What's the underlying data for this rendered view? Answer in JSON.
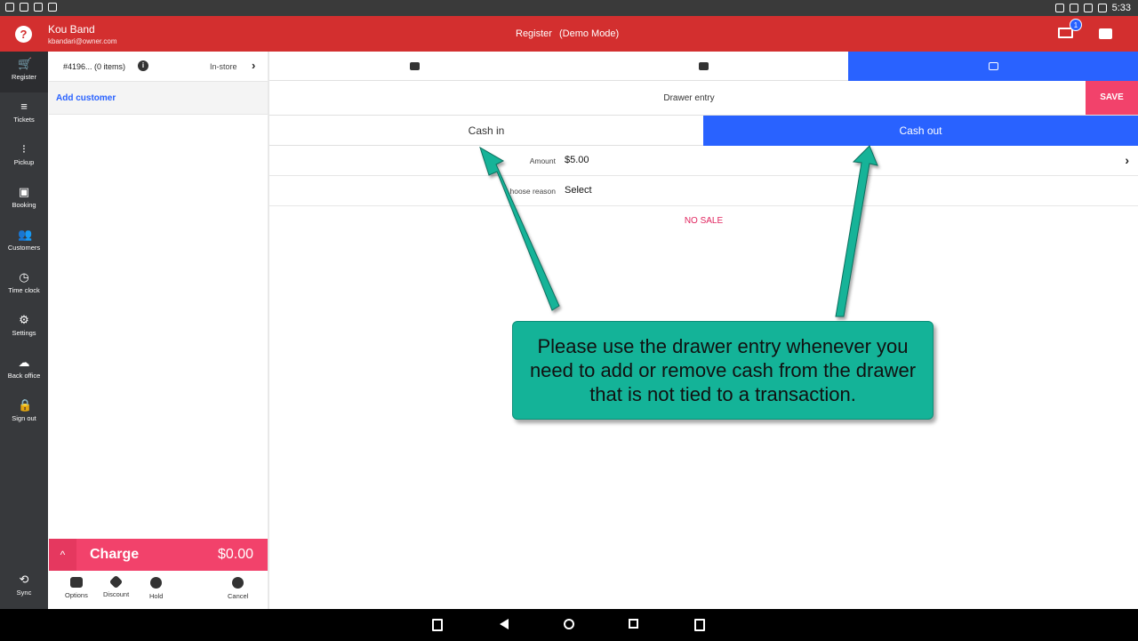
{
  "status_bar": {
    "time": "5:33"
  },
  "header": {
    "help_glyph": "?",
    "user_name": "Kou Band",
    "user_email": "kbandari@owner.com",
    "title": "Register",
    "mode": "(Demo Mode)",
    "device_badge": "1",
    "colors": {
      "brand_red": "#d32f2f",
      "accent_blue": "#2962ff",
      "accent_pink": "#f2426b"
    }
  },
  "sidebar": {
    "items": [
      {
        "label": "Register",
        "icon": "cart-icon",
        "glyph": "🛒"
      },
      {
        "label": "Tickets",
        "icon": "list-icon",
        "glyph": "≡"
      },
      {
        "label": "Pickup",
        "icon": "traffic-light-icon",
        "glyph": "⁝"
      },
      {
        "label": "Booking",
        "icon": "calendar-icon",
        "glyph": "▣"
      },
      {
        "label": "Customers",
        "icon": "people-icon",
        "glyph": "👥"
      },
      {
        "label": "Time clock",
        "icon": "clock-icon",
        "glyph": "◷"
      },
      {
        "label": "Settings",
        "icon": "gear-icon",
        "glyph": "⚙"
      },
      {
        "label": "Back office",
        "icon": "cloud-icon",
        "glyph": "☁"
      },
      {
        "label": "Sign out",
        "icon": "lock-icon",
        "glyph": "🔒"
      }
    ],
    "sync": {
      "label": "Sync",
      "icon": "sync-icon",
      "glyph": "⟲"
    }
  },
  "order": {
    "id_text": "#4196... (0 items)",
    "info_glyph": "i",
    "channel": "In-store",
    "chevron": "›",
    "add_customer": "Add customer"
  },
  "charge": {
    "chevron": "^",
    "label": "Charge",
    "amount": "$0.00"
  },
  "actions": [
    {
      "label": "Options",
      "icon": "more-icon"
    },
    {
      "label": "Discount",
      "icon": "tag-icon"
    },
    {
      "label": "Hold",
      "icon": "pause-icon"
    },
    {
      "label": "Cancel",
      "icon": "close-circle-icon"
    }
  ],
  "tabs": [
    {
      "icon": "people-icon",
      "active": false
    },
    {
      "icon": "gallery-icon",
      "active": false
    },
    {
      "icon": "drawer-icon",
      "active": true
    }
  ],
  "drawer": {
    "title": "Drawer entry",
    "save_label": "SAVE",
    "cash_in_label": "Cash in",
    "cash_out_label": "Cash out",
    "selected": "Cash out",
    "amount_label": "Amount",
    "amount_value": "$5.00",
    "reason_label": "hoose reason",
    "reason_value": "Select",
    "no_sale_label": "NO SALE"
  },
  "callout": {
    "text": "Please use the drawer entry whenever you need to add or remove cash from the drawer that is not tied to a transaction."
  }
}
